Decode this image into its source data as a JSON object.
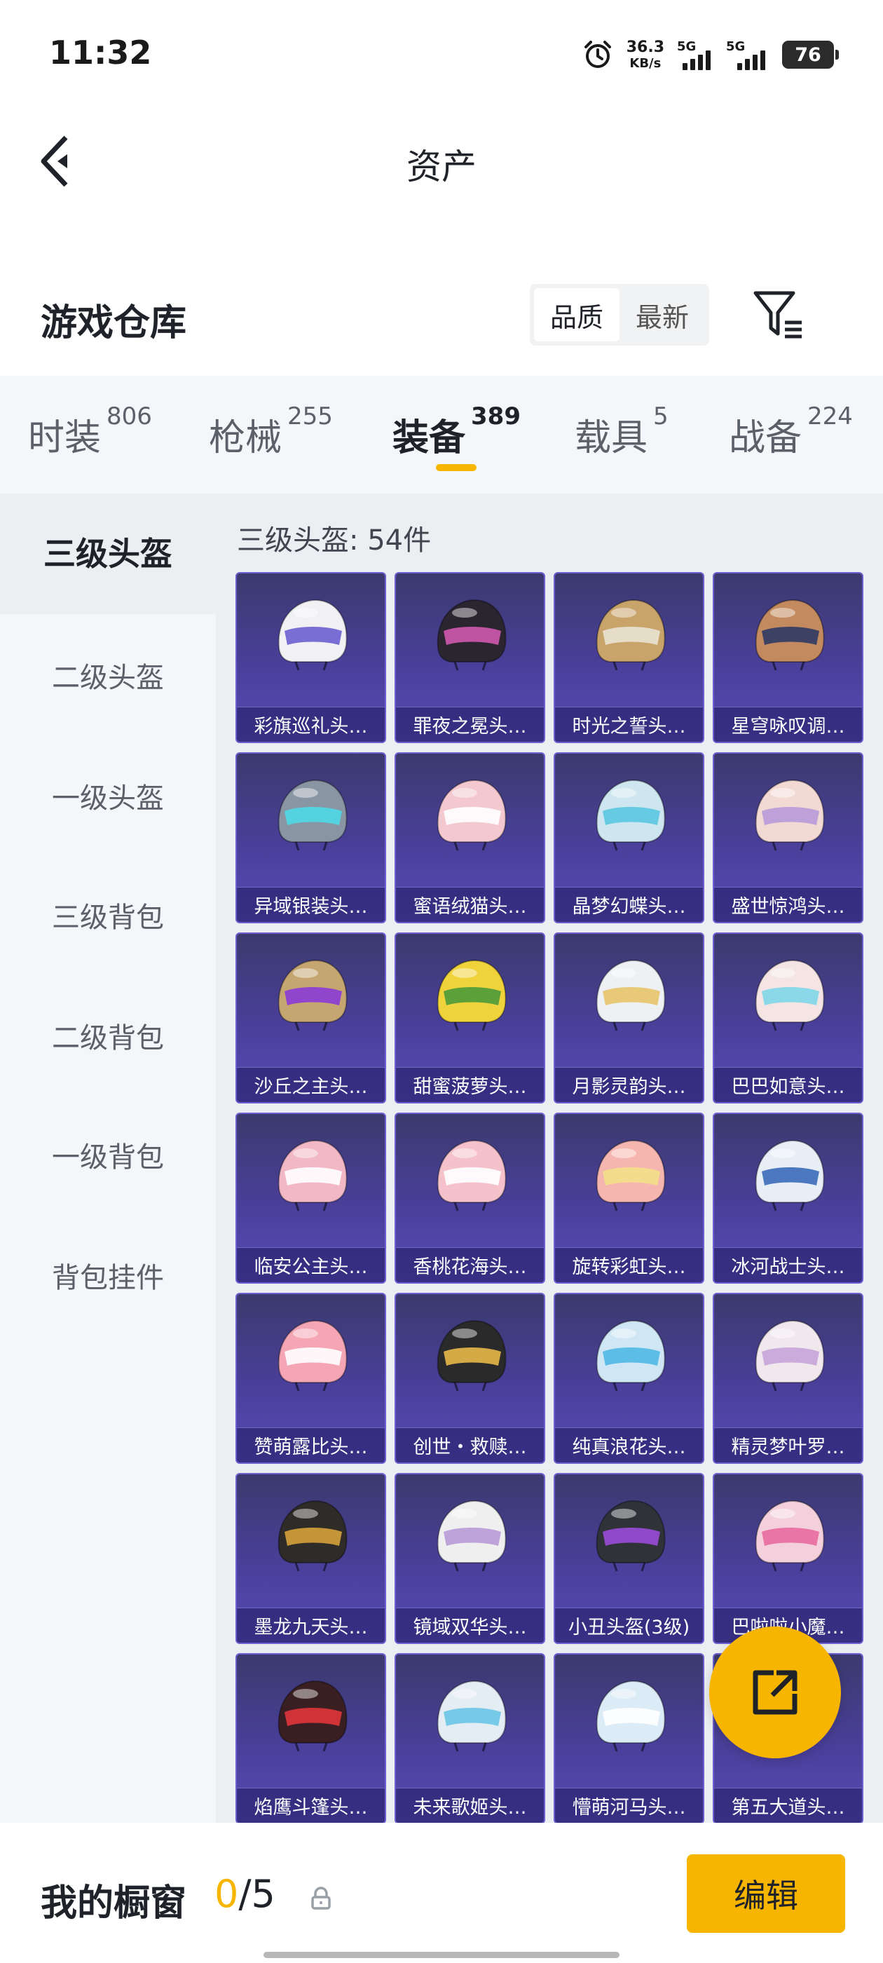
{
  "status_bar": {
    "time": "11:32",
    "net_speed_value": "36.3",
    "net_speed_unit": "KB/s",
    "sim1": "5G",
    "sim2": "5G",
    "battery": "76"
  },
  "header": {
    "title": "资产"
  },
  "toolbar": {
    "section_title": "游戏仓库",
    "sort_options": [
      "品质",
      "最新"
    ],
    "sort_selected": "品质"
  },
  "tabs": [
    {
      "label": "时装",
      "count": "806"
    },
    {
      "label": "枪械",
      "count": "255"
    },
    {
      "label": "装备",
      "count": "389",
      "active": true
    },
    {
      "label": "载具",
      "count": "5"
    },
    {
      "label": "战备",
      "count": "224"
    }
  ],
  "sidebar": {
    "items": [
      {
        "label": "三级头盔",
        "active": true
      },
      {
        "label": "二级头盔"
      },
      {
        "label": "一级头盔"
      },
      {
        "label": "三级背包"
      },
      {
        "label": "二级背包"
      },
      {
        "label": "一级背包"
      },
      {
        "label": "背包挂件"
      }
    ]
  },
  "grid": {
    "count_label": "三级头盔: 54件",
    "items": [
      {
        "name": "彩旗巡礼头…",
        "color": "#f1f1f4",
        "accent": "#6b5fd0"
      },
      {
        "name": "罪夜之冕头…",
        "color": "#2b2530",
        "accent": "#d05ab0"
      },
      {
        "name": "时光之誓头…",
        "color": "#c9a46a",
        "accent": "#e9e3d4"
      },
      {
        "name": "星穹咏叹调…",
        "color": "#c28a5e",
        "accent": "#2f3a66"
      },
      {
        "name": "异域银装头…",
        "color": "#8a95a3",
        "accent": "#4fd8e6"
      },
      {
        "name": "蜜语绒猫头…",
        "color": "#f3c8cf",
        "accent": "#ffffff"
      },
      {
        "name": "晶梦幻蝶头…",
        "color": "#cde6ef",
        "accent": "#5ac6e0"
      },
      {
        "name": "盛世惊鸿头…",
        "color": "#f2d9d4",
        "accent": "#b89ad8"
      },
      {
        "name": "沙丘之主头…",
        "color": "#c6a670",
        "accent": "#8a3bd6"
      },
      {
        "name": "甜蜜菠萝头…",
        "color": "#f0d23a",
        "accent": "#4a9a3a"
      },
      {
        "name": "月影灵韵头…",
        "color": "#eef0f4",
        "accent": "#e6c46a"
      },
      {
        "name": "巴巴如意头…",
        "color": "#f4e4e4",
        "accent": "#7fd6e8"
      },
      {
        "name": "临安公主头…",
        "color": "#f2b8c6",
        "accent": "#ffffff"
      },
      {
        "name": "香桃花海头…",
        "color": "#f5c2cc",
        "accent": "#ffffff"
      },
      {
        "name": "旋转彩虹头…",
        "color": "#f6b6b0",
        "accent": "#f4e08a"
      },
      {
        "name": "冰河战士头…",
        "color": "#e8eef6",
        "accent": "#3a6ab8"
      },
      {
        "name": "赞萌露比头…",
        "color": "#f4a6b4",
        "accent": "#ffffff"
      },
      {
        "name": "创世・救赎…",
        "color": "#2a2a2a",
        "accent": "#e7b84a"
      },
      {
        "name": "纯真浪花头…",
        "color": "#cfe6f4",
        "accent": "#4fb8e6"
      },
      {
        "name": "精灵梦叶罗…",
        "color": "#f1e8ee",
        "accent": "#c6a4d8"
      },
      {
        "name": "墨龙九天头…",
        "color": "#2e2b28",
        "accent": "#d6a23a"
      },
      {
        "name": "镜域双华头…",
        "color": "#efefef",
        "accent": "#b89ad8"
      },
      {
        "name": "小丑头盔(3级)",
        "color": "#2f3338",
        "accent": "#9a4ad8"
      },
      {
        "name": "巴啦啦小魔…",
        "color": "#f4d0dc",
        "accent": "#e86aa0"
      },
      {
        "name": "焰鹰斗篷头…",
        "color": "#3a1f22",
        "accent": "#e0343a"
      },
      {
        "name": "未来歌姬头…",
        "color": "#e4ecf4",
        "accent": "#6ac6e6"
      },
      {
        "name": "懵萌河马头…",
        "color": "#dcecf6",
        "accent": "#ffffff"
      },
      {
        "name": "第五大道头…",
        "color": "#efe4d2",
        "accent": "#c08a4a"
      }
    ]
  },
  "bottom_bar": {
    "showcase_label": "我的橱窗",
    "showcase_filled": "0",
    "showcase_total": "/5",
    "edit_label": "编辑"
  },
  "icons": {
    "back": "chevron-left-icon",
    "filter": "filter-icon",
    "share": "share-icon",
    "lock": "lock-icon",
    "alarm": "alarm-icon"
  },
  "colors": {
    "accent": "#f7b500",
    "card_bg": "#4a3f9a",
    "tab_bg": "#f4f6f9"
  }
}
